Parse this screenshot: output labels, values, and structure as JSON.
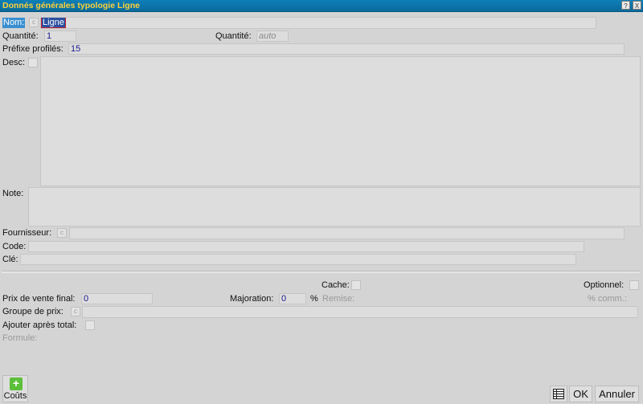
{
  "window": {
    "title": "Donnés générales typologie Ligne",
    "help_label": "?",
    "close_label": "X"
  },
  "form": {
    "nom": {
      "label": "Nom:",
      "value": "Ligne",
      "c_label": "c"
    },
    "quantite1": {
      "label": "Quantité:",
      "value": "1"
    },
    "quantite2": {
      "label": "Quantité:",
      "value": "auto"
    },
    "prefixe": {
      "label": "Préfixe profilés:",
      "value": "15"
    },
    "desc": {
      "label": "Desc:",
      "value": ""
    },
    "note": {
      "label": "Note:",
      "value": ""
    },
    "fournisseur": {
      "label": "Fournisseur:",
      "c_label": "c",
      "value": ""
    },
    "code": {
      "label": "Code:",
      "value": ""
    },
    "cle": {
      "label": "Clé:",
      "value": ""
    },
    "cache": {
      "label": "Cache:"
    },
    "optionnel": {
      "label": "Optionnel:"
    },
    "prix_vente": {
      "label": "Prix de vente final:",
      "value": "0"
    },
    "majoration": {
      "label": "Majoration:",
      "value": "0",
      "unit": "%"
    },
    "remise": {
      "label": "Remise:"
    },
    "comm": {
      "label": "% comm.:"
    },
    "groupe_prix": {
      "label": "Groupe de prix:",
      "c_label": "c",
      "value": ""
    },
    "ajouter": {
      "label": "Ajouter après total:"
    },
    "formule": {
      "label": "Formule:"
    }
  },
  "footer": {
    "couts_label": "Coûts",
    "add_icon_label": "+",
    "ok_label": "OK",
    "annuler_label": "Annuler"
  },
  "colors": {
    "titlebar": "#0a6a9c",
    "title_text": "#ffd23a",
    "value_text": "#1a1a8c",
    "selected_label_bg": "#3a8fd0",
    "selected_value_bg": "#2b4fa0",
    "add_button": "#5cbf3a"
  }
}
